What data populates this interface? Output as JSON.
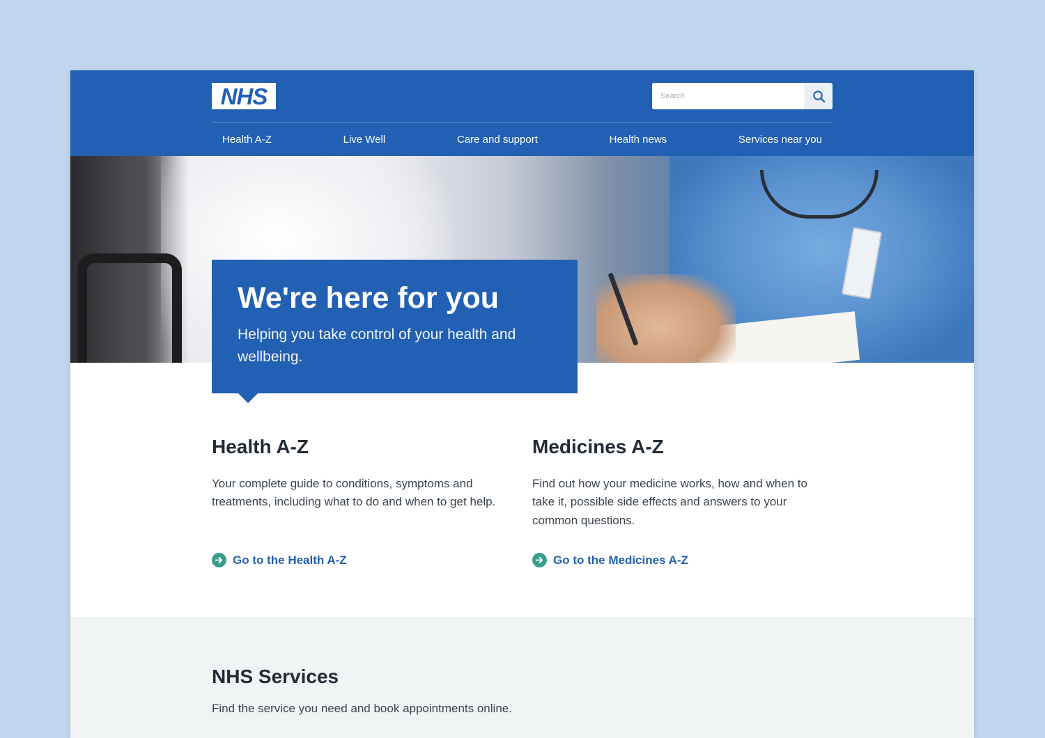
{
  "header": {
    "logo_text": "NHS",
    "search": {
      "placeholder": "Search",
      "value": ""
    },
    "search_icon": "search-icon",
    "nav": [
      {
        "label": "Health A-Z"
      },
      {
        "label": "Live Well"
      },
      {
        "label": "Care and support"
      },
      {
        "label": "Health news"
      },
      {
        "label": "Services near you"
      }
    ]
  },
  "hero": {
    "title": "We're here for you",
    "subtitle": "Helping you take control of your health and wellbeing."
  },
  "columns": [
    {
      "title": "Health A-Z",
      "description": "Your complete guide to conditions, symptoms and treatments, including what to do and when to get help.",
      "link_label": "Go to the Health A-Z",
      "link_icon": "arrow-right-circle-icon"
    },
    {
      "title": "Medicines A-Z",
      "description": "Find out how your medicine works, how and when to take it, possible side effects and answers to your common questions.",
      "link_label": "Go to the Medicines A-Z",
      "link_icon": "arrow-right-circle-icon"
    }
  ],
  "services": {
    "title": "NHS Services",
    "description": "Find the service you need and book appointments online."
  },
  "colors": {
    "brand_blue": "#2260b3",
    "link_arrow_green": "#3a9d8e",
    "page_background": "#c2d7ee",
    "services_background": "#f0f4f5"
  }
}
